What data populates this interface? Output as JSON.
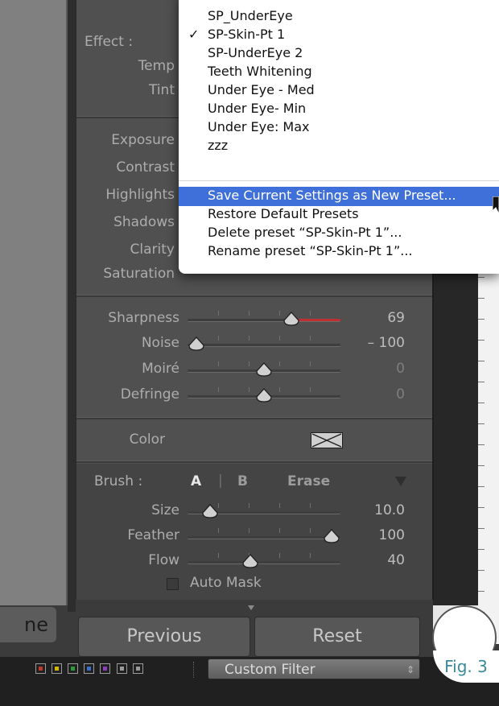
{
  "menu": {
    "items": [
      {
        "label": "SP_UnderEye",
        "checked": false
      },
      {
        "label": "SP-Skin-Pt 1",
        "checked": true
      },
      {
        "label": "SP-UnderEye 2",
        "checked": false
      },
      {
        "label": "Teeth Whitening",
        "checked": false
      },
      {
        "label": "Under Eye - Med",
        "checked": false
      },
      {
        "label": "Under Eye- Min",
        "checked": false
      },
      {
        "label": "Under Eye: Max",
        "checked": false
      },
      {
        "label": "zzz",
        "checked": false
      }
    ],
    "check_mark": "✓",
    "actions": [
      "Save Current Settings as New Preset...",
      "Restore Default Presets",
      "Delete preset “SP-Skin-Pt 1”...",
      "Rename preset “SP-Skin-Pt 1”..."
    ],
    "highlight_color": "#3f6fd8"
  },
  "effect": {
    "label": "Effect :",
    "rows": [
      "Temp",
      "Tint"
    ]
  },
  "tone": {
    "rows": [
      "Exposure",
      "Contrast",
      "Highlights",
      "Shadows",
      "Clarity",
      "Saturation"
    ]
  },
  "detail": {
    "sliders": [
      {
        "label": "Sharpness",
        "value": "69",
        "level": 0.7
      },
      {
        "label": "Noise",
        "value": "– 100",
        "level": 0.0
      },
      {
        "label": "Moiré",
        "value": "0",
        "level": 0.5
      },
      {
        "label": "Defringe",
        "value": "0",
        "level": 0.5
      }
    ]
  },
  "color": {
    "label": "Color",
    "swatch_icon": "color-swatch-empty-icon"
  },
  "brush": {
    "label": "Brush :",
    "tab_a": "A",
    "divider": "|",
    "tab_b": "B",
    "erase": "Erase",
    "sliders": [
      {
        "label": "Size",
        "value": "10.0",
        "level": 0.1
      },
      {
        "label": "Feather",
        "value": "100",
        "level": 1.0
      },
      {
        "label": "Flow",
        "value": "40",
        "level": 0.4
      }
    ],
    "auto_mask": "Auto Mask",
    "auto_mask_checked": false
  },
  "buttons": {
    "left_partial": "ne",
    "previous": "Previous",
    "reset": "Reset"
  },
  "filter_bar": {
    "swatch_colors": [
      "#c0392b",
      "#d4b800",
      "#2e9b3a",
      "#3a6fd0",
      "#8a3fc0",
      "#9a9a9a",
      "#9a9a9a"
    ],
    "filter_label": "Custom Filter"
  },
  "figure": {
    "label": "Fig. 3",
    "accent": "#3a8a9a"
  }
}
